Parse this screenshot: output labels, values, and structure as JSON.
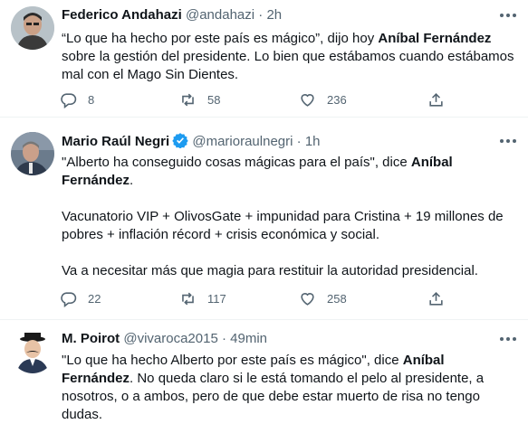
{
  "tweets": [
    {
      "name": "Federico Andahazi",
      "handle": "@andahazi",
      "sep": " · ",
      "time": "2h",
      "text": {
        "p1_a": "“Lo que ha hecho por este país es mágico”, dijo hoy ",
        "p1_b": "Aníbal Fernández",
        "p1_c": " sobre la gestión del presidente. Lo bien que estábamos cuando estábamos mal con el Mago Sin Dientes."
      },
      "replies": "8",
      "retweets": "58",
      "likes": "236"
    },
    {
      "name": "Mario Raúl Negri",
      "handle": "@marioraulnegri",
      "sep": " · ",
      "time": "1h",
      "verified": true,
      "text": {
        "p1_a": "\"Alberto ha conseguido cosas mágicas para el país\", dice ",
        "p1_b": "Aníbal Fernández",
        "p1_c": ".",
        "p2": "Vacunatorio VIP + OlivosGate + impunidad para Cristina + 19 millones de pobres + inflación récord + crisis económica y social.",
        "p3": "Va a necesitar más que magia para restituir la autoridad presidencial."
      },
      "replies": "22",
      "retweets": "117",
      "likes": "258"
    },
    {
      "name": "M. Poirot",
      "handle": "@vivaroca2015",
      "sep": " · ",
      "time": "49min",
      "text": {
        "p1_a": "\"Lo que ha hecho Alberto por este país es mágico\", dice ",
        "p1_b": "Aníbal Fernández",
        "p1_c": ". No queda claro si le está tomando el pelo al presidente, a nosotros, o a ambos, pero de que debe estar muerto de risa no tengo dudas."
      }
    }
  ],
  "colors": {
    "accent": "#1d9bf0",
    "muted": "#536471",
    "text": "#0f1419",
    "divider": "#eff3f4"
  },
  "icons": [
    "more-icon",
    "reply-icon",
    "retweet-icon",
    "like-icon",
    "share-icon",
    "verified-badge-icon"
  ]
}
